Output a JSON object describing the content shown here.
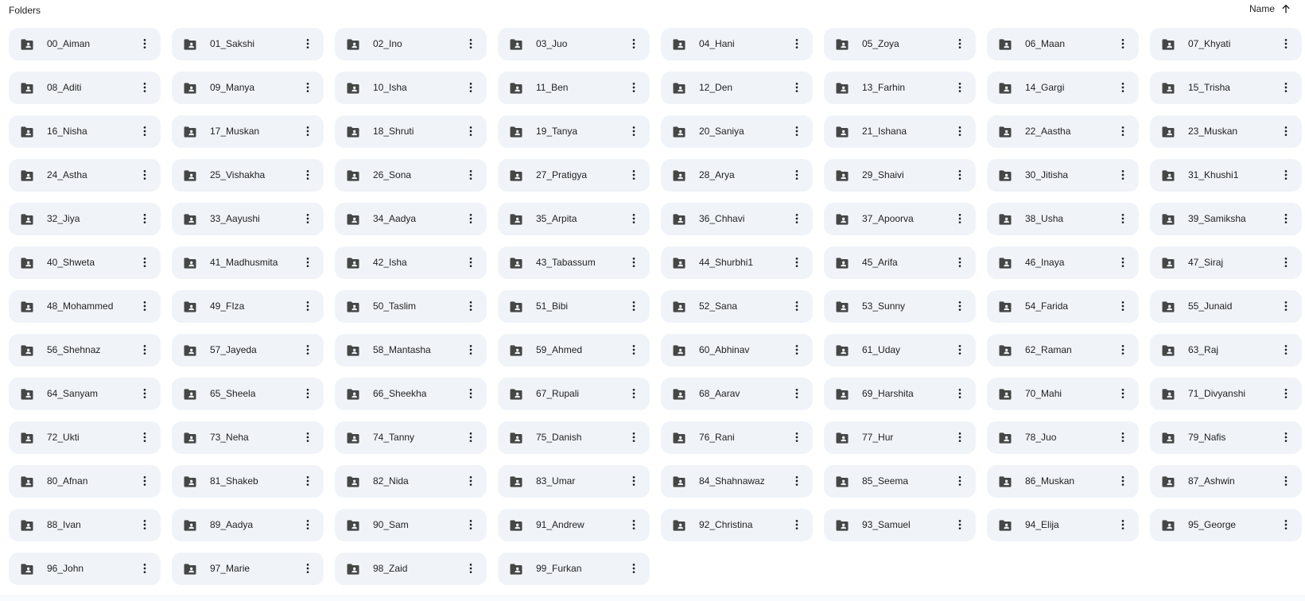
{
  "header": {
    "section_title": "Folders",
    "sort_label": "Name",
    "sort_icon": "arrow-upward-icon"
  },
  "icons": {
    "folder": "shared-folder-icon",
    "more": "more-vert-icon"
  },
  "colors": {
    "card_background": "#f0f4f9",
    "icon_color": "#444746",
    "text_color": "#1f1f1f"
  },
  "folders": [
    "00_Aiman",
    "01_Sakshi",
    "02_Ino",
    "03_Juo",
    "04_Hani",
    "05_Zoya",
    "06_Maan",
    "07_Khyati",
    "08_Aditi",
    "09_Manya",
    "10_Isha",
    "11_Ben",
    "12_Den",
    "13_Farhin",
    "14_Gargi",
    "15_Trisha",
    "16_Nisha",
    "17_Muskan",
    "18_Shruti",
    "19_Tanya",
    "20_Saniya",
    "21_Ishana",
    "22_Aastha",
    "23_Muskan",
    "24_Astha",
    "25_Vishakha",
    "26_Sona",
    "27_Pratigya",
    "28_Arya",
    "29_Shaivi",
    "30_Jitisha",
    "31_Khushi1",
    "32_Jiya",
    "33_Aayushi",
    "34_Aadya",
    "35_Arpita",
    "36_Chhavi",
    "37_Apoorva",
    "38_Usha",
    "39_Samiksha",
    "40_Shweta",
    "41_Madhusmita",
    "42_Isha",
    "43_Tabassum",
    "44_Shurbhi1",
    "45_Arifa",
    "46_Inaya",
    "47_Siraj",
    "48_Mohammed",
    "49_FIza",
    "50_Taslim",
    "51_Bibi",
    "52_Sana",
    "53_Sunny",
    "54_Farida",
    "55_Junaid",
    "56_Shehnaz",
    "57_Jayeda",
    "58_Mantasha",
    "59_Ahmed",
    "60_Abhinav",
    "61_Uday",
    "62_Raman",
    "63_Raj",
    "64_Sanyam",
    "65_Sheela",
    "66_Sheekha",
    "67_Rupali",
    "68_Aarav",
    "69_Harshita",
    "70_Mahi",
    "71_Divyanshi",
    "72_Ukti",
    "73_Neha",
    "74_Tanny",
    "75_Danish",
    "76_Rani",
    "77_Hur",
    "78_Juo",
    "79_Nafis",
    "80_Afnan",
    "81_Shakeb",
    "82_Nida",
    "83_Umar",
    "84_Shahnawaz",
    "85_Seema",
    "86_Muskan",
    "87_Ashwin",
    "88_Ivan",
    "89_Aadya",
    "90_Sam",
    "91_Andrew",
    "92_Christina",
    "93_Samuel",
    "94_Elija",
    "95_George",
    "96_John",
    "97_Marie",
    "98_Zaid",
    "99_Furkan"
  ]
}
